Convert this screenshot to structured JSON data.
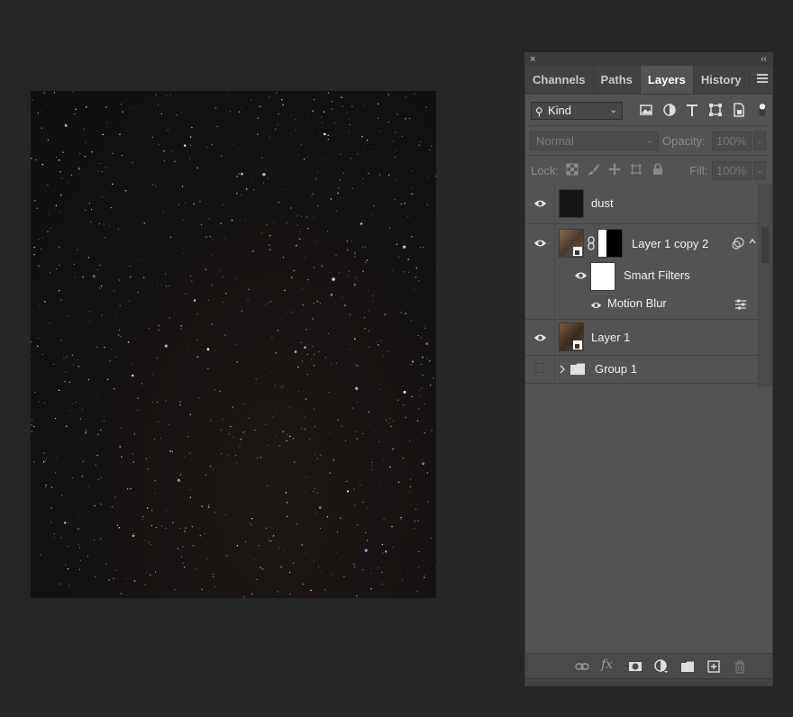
{
  "panel": {
    "close_label": "×",
    "collapse_label": "‹‹",
    "tabs": [
      {
        "label": "Channels",
        "active": false
      },
      {
        "label": "Paths",
        "active": false
      },
      {
        "label": "Layers",
        "active": true
      },
      {
        "label": "History",
        "active": false
      }
    ]
  },
  "filter": {
    "kind_label": "Kind",
    "icons": [
      "image-filter-icon",
      "adjustment-filter-icon",
      "type-filter-icon",
      "shape-filter-icon",
      "smart-object-filter-icon",
      "filter-toggle-icon"
    ]
  },
  "blend": {
    "mode": "Normal",
    "opacity_label": "Opacity:",
    "opacity_value": "100%",
    "lock_label": "Lock:",
    "fill_label": "Fill:",
    "fill_value": "100%"
  },
  "layers": [
    {
      "name": "dust",
      "visible": true
    },
    {
      "name": "Layer 1 copy 2",
      "visible": true
    },
    {
      "name": "Smart Filters",
      "visible": true
    },
    {
      "name": "Motion Blur",
      "visible": true
    },
    {
      "name": "Layer 1",
      "visible": true
    },
    {
      "name": "Group 1",
      "visible": false
    }
  ],
  "bottom_icons": [
    "link-icon",
    "fx-icon",
    "mask-icon",
    "adjustment-icon",
    "folder-icon",
    "new-layer-icon",
    "trash-icon"
  ],
  "colors": {
    "panel_bg": "#535353",
    "app_bg": "#262626",
    "canvas_bg": "#141212"
  }
}
